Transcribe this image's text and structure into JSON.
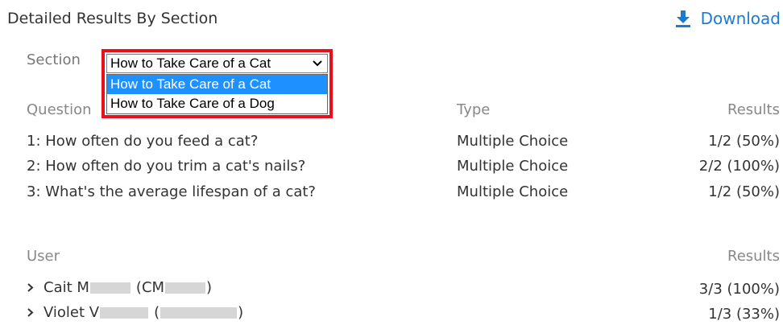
{
  "header": {
    "title": "Detailed Results By Section",
    "download_label": "Download"
  },
  "section_filter": {
    "label": "Section",
    "selected": "How to Take Care of a Cat",
    "options": [
      "How to Take Care of a Cat",
      "How to Take Care of a Dog"
    ]
  },
  "questions": {
    "columns": {
      "question": "Question",
      "type": "Type",
      "results": "Results"
    },
    "rows": [
      {
        "question": "1: How often do you feed a cat?",
        "type": "Multiple Choice",
        "results": "1/2 (50%)"
      },
      {
        "question": "2: How often do you trim a cat's nails?",
        "type": "Multiple Choice",
        "results": "2/2 (100%)"
      },
      {
        "question": "3: What's the average lifespan of a cat?",
        "type": "Multiple Choice",
        "results": "1/2 (50%)"
      }
    ]
  },
  "users": {
    "columns": {
      "user": "User",
      "results": "Results"
    },
    "rows": [
      {
        "name_start": "Cait M",
        "id_start": "(CM",
        "id_end": ")",
        "results": "3/3 (100%)"
      },
      {
        "name_start": "Violet V",
        "id_start": "(",
        "id_end": ")",
        "results": "1/3 (33%)"
      }
    ]
  },
  "colors": {
    "accent": "#1a7bd3",
    "highlight_border": "#e8101f",
    "selected_option": "#1e90ff"
  },
  "icons": {
    "download": "download-arrow-icon",
    "select_caret": "chevron-down-icon",
    "row_expand": "chevron-right-icon"
  }
}
